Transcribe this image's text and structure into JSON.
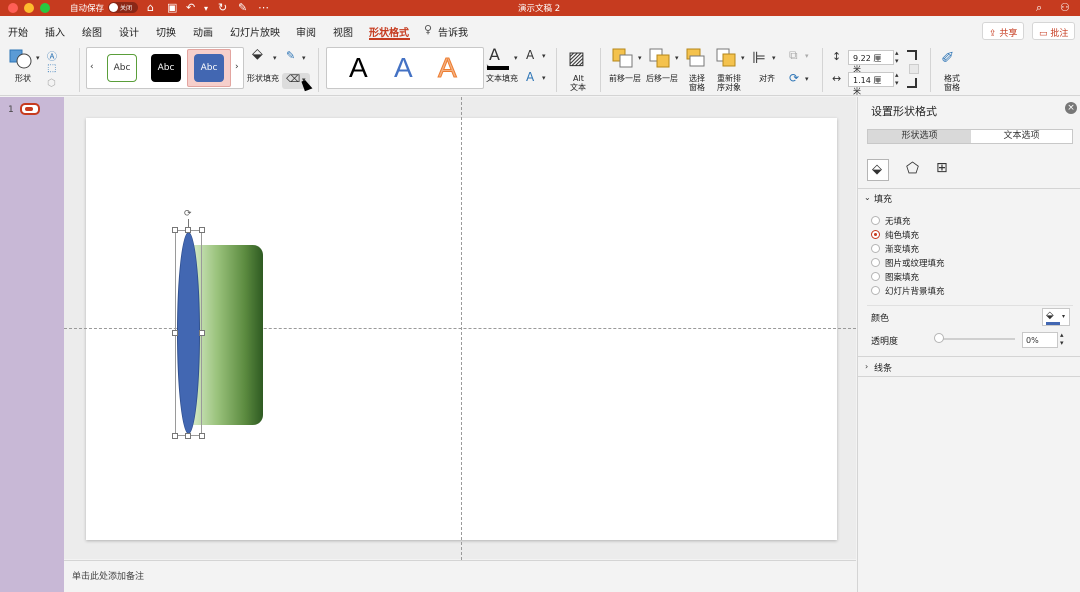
{
  "titlebar": {
    "autosave_label": "自动保存",
    "autosave_state": "关闭",
    "doc_title": "演示文稿 2"
  },
  "tabs": [
    {
      "label": "开始"
    },
    {
      "label": "插入"
    },
    {
      "label": "绘图"
    },
    {
      "label": "设计"
    },
    {
      "label": "切换"
    },
    {
      "label": "动画"
    },
    {
      "label": "幻灯片放映"
    },
    {
      "label": "审阅"
    },
    {
      "label": "视图"
    },
    {
      "label": "形状格式",
      "active": true
    },
    {
      "label": "告诉我"
    }
  ],
  "header_buttons": {
    "share": "共享",
    "comment": "批注"
  },
  "ribbon": {
    "shape_label": "形状",
    "style_gallery": [
      "Abc",
      "Abc",
      "Abc"
    ],
    "shape_fill_label": "形状填充",
    "wordart_letters": [
      "A",
      "A",
      "A"
    ],
    "text_fill_label": "文本填充",
    "alt_text_label_1": "Alt",
    "alt_text_label_2": "文本",
    "bring_forward": "前移一层",
    "send_backward": "后移一层",
    "selection_pane_1": "选择",
    "selection_pane_2": "窗格",
    "reorder_1": "重新排",
    "reorder_2": "序对象",
    "align": "对齐",
    "height_value": "9.22 厘米",
    "width_value": "1.14 厘米",
    "format_pane_1": "格式",
    "format_pane_2": "窗格"
  },
  "thumbs": {
    "slide_number": "1"
  },
  "notes": {
    "placeholder": "单击此处添加备注"
  },
  "pane": {
    "title": "设置形状格式",
    "tab_shape": "形状选项",
    "tab_text": "文本选项",
    "fill_section": "填充",
    "fill_options": [
      {
        "label": "无填充",
        "selected": false
      },
      {
        "label": "纯色填充",
        "selected": true
      },
      {
        "label": "渐变填充",
        "selected": false
      },
      {
        "label": "图片或纹理填充",
        "selected": false
      },
      {
        "label": "图案填充",
        "selected": false
      },
      {
        "label": "幻灯片背景填充",
        "selected": false
      }
    ],
    "color_label": "颜色",
    "transparency_label": "透明度",
    "transparency_value": "0%",
    "line_section": "线条"
  },
  "colors": {
    "accent": "#c63b1f",
    "ellipse_fill": "#4267b2",
    "gradient_light": "#bcd9a8",
    "gradient_dark": "#2e5a22"
  }
}
